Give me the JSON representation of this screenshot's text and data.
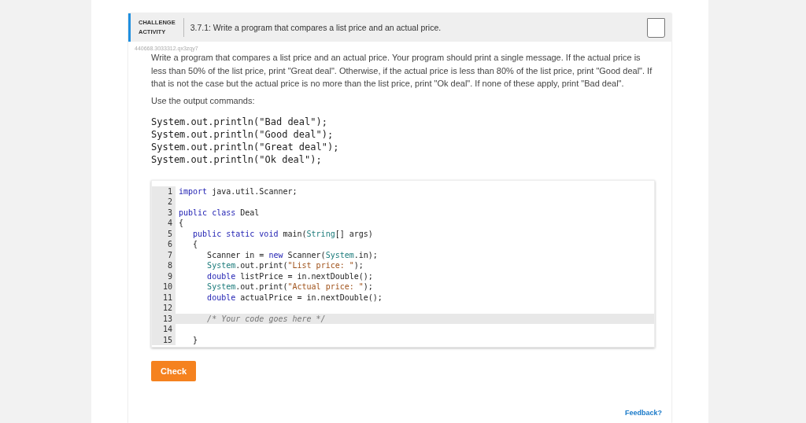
{
  "header": {
    "label": "CHALLENGE\nACTIVITY",
    "title": "3.7.1: Write a program that compares a list price and an actual price.",
    "completed": false
  },
  "activity_id": "440668.3033312.qx3zqy7",
  "description": "Write a program that compares a list price and an actual price. Your program should print a single message. If the actual price is less than 50% of the list price, print \"Great deal\". Otherwise, if the actual price is less than 80% of the list price, print \"Good deal\". If that is not the case but the actual price is no more than the list price, print \"Ok deal\". If none of these apply, print \"Bad deal\".",
  "instruction": "Use the output commands:",
  "output_commands": [
    "System.out.println(\"Bad deal\");",
    "System.out.println(\"Good deal\");",
    "System.out.println(\"Great deal\");",
    "System.out.println(\"Ok deal\");"
  ],
  "editor": {
    "lines": [
      {
        "number": "1",
        "active": false,
        "tokens": [
          {
            "kind": "keyword",
            "text": "import"
          },
          {
            "kind": "plain",
            "text": " java.util.Scanner;"
          }
        ]
      },
      {
        "number": "2",
        "active": false
      },
      {
        "number": "3",
        "active": false,
        "tokens": [
          {
            "kind": "keyword",
            "text": "public class"
          },
          {
            "kind": "plain",
            "text": " Deal"
          }
        ]
      },
      {
        "number": "4",
        "active": false,
        "tokens": [
          {
            "kind": "plain",
            "text": "{"
          }
        ]
      },
      {
        "number": "5",
        "active": false,
        "tokens": [
          {
            "kind": "keyword",
            "text": "   public static void"
          },
          {
            "kind": "plain",
            "text": " main("
          },
          {
            "kind": "type",
            "text": "String"
          },
          {
            "kind": "plain",
            "text": "[] args)"
          }
        ]
      },
      {
        "number": "6",
        "active": false,
        "tokens": [
          {
            "kind": "plain",
            "text": "   {"
          }
        ]
      },
      {
        "number": "7",
        "active": false,
        "tokens": [
          {
            "kind": "plain",
            "text": "      Scanner in = "
          },
          {
            "kind": "keyword",
            "text": "new"
          },
          {
            "kind": "plain",
            "text": " Scanner("
          },
          {
            "kind": "type",
            "text": "System"
          },
          {
            "kind": "plain",
            "text": ".in);"
          }
        ]
      },
      {
        "number": "8",
        "active": false,
        "tokens": [
          {
            "kind": "type",
            "text": "      System"
          },
          {
            "kind": "plain",
            "text": ".out.print("
          },
          {
            "kind": "string",
            "text": "\"List price: \""
          },
          {
            "kind": "plain",
            "text": ");"
          }
        ]
      },
      {
        "number": "9",
        "active": false,
        "tokens": [
          {
            "kind": "keyword",
            "text": "      double"
          },
          {
            "kind": "plain",
            "text": " listPrice = in.nextDouble();"
          }
        ]
      },
      {
        "number": "10",
        "active": false,
        "tokens": [
          {
            "kind": "type",
            "text": "      System"
          },
          {
            "kind": "plain",
            "text": ".out.print("
          },
          {
            "kind": "string",
            "text": "\"Actual price: \""
          },
          {
            "kind": "plain",
            "text": ");"
          }
        ]
      },
      {
        "number": "11",
        "active": false,
        "tokens": [
          {
            "kind": "keyword",
            "text": "      double"
          },
          {
            "kind": "plain",
            "text": " actualPrice = in.nextDouble();"
          }
        ]
      },
      {
        "number": "12",
        "active": false
      },
      {
        "number": "13",
        "active": true,
        "tokens": [
          {
            "kind": "comment",
            "text": "      /* Your code goes here */"
          }
        ]
      },
      {
        "number": "14",
        "active": false
      },
      {
        "number": "15",
        "active": false,
        "tokens": [
          {
            "kind": "plain",
            "text": "   }"
          }
        ]
      }
    ]
  },
  "check_button": "Check",
  "feedback_link": "Feedback?"
}
